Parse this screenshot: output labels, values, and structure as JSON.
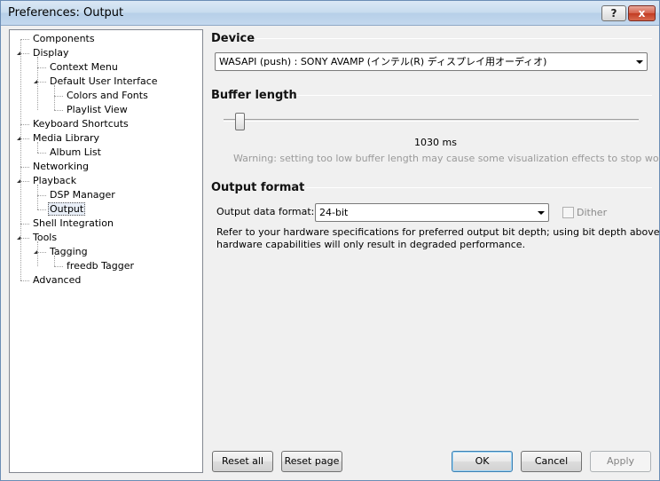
{
  "window": {
    "title": "Preferences: Output",
    "help_label": "?",
    "close_label": "x"
  },
  "tree": {
    "items": [
      {
        "label": "Components",
        "level": 0,
        "expander": false
      },
      {
        "label": "Display",
        "level": 0,
        "expander": true
      },
      {
        "label": "Context Menu",
        "level": 1,
        "expander": false
      },
      {
        "label": "Default User Interface",
        "level": 1,
        "expander": true
      },
      {
        "label": "Colors and Fonts",
        "level": 2,
        "expander": false
      },
      {
        "label": "Playlist View",
        "level": 2,
        "expander": false
      },
      {
        "label": "Keyboard Shortcuts",
        "level": 0,
        "expander": false
      },
      {
        "label": "Media Library",
        "level": 0,
        "expander": true
      },
      {
        "label": "Album List",
        "level": 1,
        "expander": false
      },
      {
        "label": "Networking",
        "level": 0,
        "expander": false
      },
      {
        "label": "Playback",
        "level": 0,
        "expander": true
      },
      {
        "label": "DSP Manager",
        "level": 1,
        "expander": false
      },
      {
        "label": "Output",
        "level": 1,
        "expander": false,
        "selected": true
      },
      {
        "label": "Shell Integration",
        "level": 0,
        "expander": false
      },
      {
        "label": "Tools",
        "level": 0,
        "expander": true
      },
      {
        "label": "Tagging",
        "level": 1,
        "expander": true
      },
      {
        "label": "freedb Tagger",
        "level": 2,
        "expander": false
      },
      {
        "label": "Advanced",
        "level": 0,
        "expander": false
      }
    ]
  },
  "device": {
    "heading": "Device",
    "selected": "WASAPI (push) : SONY AVAMP (インテル(R) ディスプレイ用オーディオ)"
  },
  "buffer": {
    "heading": "Buffer length",
    "value_text": "1030 ms",
    "slider_fraction": 0.04,
    "warning": "Warning: setting too low buffer length may cause some visualization effects to stop working."
  },
  "output_format": {
    "heading": "Output format",
    "format_label": "Output data format:",
    "format_value": "24-bit",
    "dither_label": "Dither",
    "dither_checked": false,
    "note_line1": "Refer to your hardware specifications for preferred output bit depth; using bit depth above your",
    "note_line2": "hardware capabilities will only result in degraded performance."
  },
  "buttons": {
    "reset_all": "Reset all",
    "reset_page": "Reset page",
    "ok": "OK",
    "cancel": "Cancel",
    "apply": "Apply"
  }
}
